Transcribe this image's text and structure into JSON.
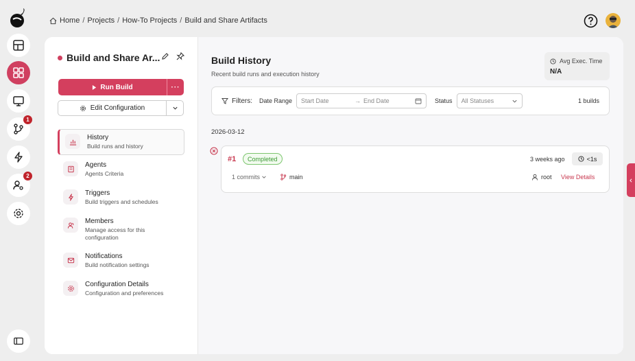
{
  "breadcrumb": [
    "Home",
    "Projects",
    "How-To Projects",
    "Build and Share Artifacts"
  ],
  "rail": {
    "badges": {
      "merge": "1",
      "users": "2"
    }
  },
  "config": {
    "title": "Build and Share Ar...",
    "run_label": "Run Build",
    "more_label": "···",
    "edit_label": "Edit Configuration"
  },
  "nav": [
    {
      "label": "History",
      "desc": "Build runs and history",
      "active": true,
      "icon": "chart-icon"
    },
    {
      "label": "Agents",
      "desc": "Agents Criteria",
      "icon": "agent-icon"
    },
    {
      "label": "Triggers",
      "desc": "Build triggers and schedules",
      "icon": "bolt-icon"
    },
    {
      "label": "Members",
      "desc": "Manage access for this configuration",
      "icon": "members-icon"
    },
    {
      "label": "Notifications",
      "desc": "Build notification settings",
      "icon": "mail-icon"
    },
    {
      "label": "Configuration Details",
      "desc": "Configuration and preferences",
      "icon": "gear-icon"
    }
  ],
  "history": {
    "title": "Build History",
    "subtitle": "Recent build runs and execution history",
    "avg_label": "Avg Exec. Time",
    "avg_value": "N/A"
  },
  "filters": {
    "label": "Filters:",
    "date_range_label": "Date Range",
    "start_placeholder": "Start Date",
    "end_placeholder": "End Date",
    "arrow": "→",
    "status_label": "Status",
    "status_value": "All Statuses",
    "count": "1 builds"
  },
  "groups": [
    {
      "date": "2026-03-12",
      "builds": [
        {
          "number": "#1",
          "status": "Completed",
          "ago": "3 weeks ago",
          "duration": "<1s",
          "commits": "1 commits",
          "branch": "main",
          "user": "root",
          "details": "View Details"
        }
      ]
    }
  ],
  "colors": {
    "accent": "#d43f5e",
    "success": "#3c9a34",
    "fail": "#c8384f"
  }
}
